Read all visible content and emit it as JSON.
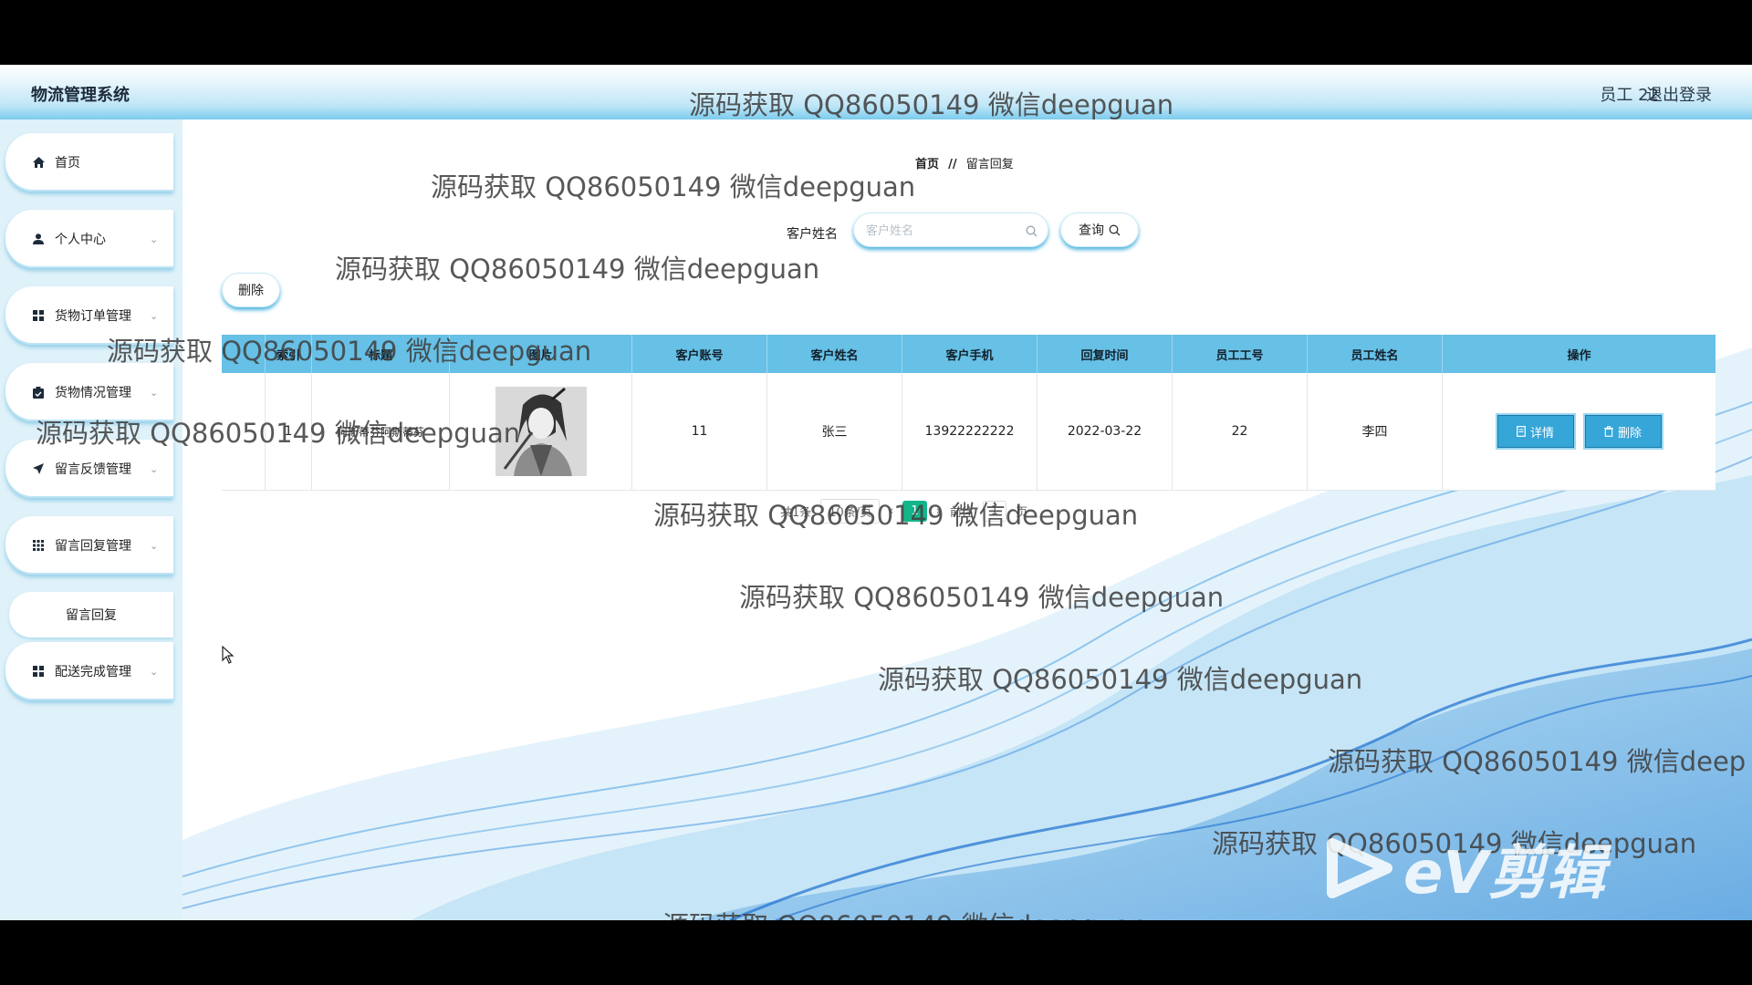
{
  "app": {
    "title": "物流管理系统"
  },
  "header": {
    "user": "员工 22",
    "logout": "退出登录"
  },
  "sidebar": {
    "items": [
      {
        "label": "首页",
        "icon": "home-icon"
      },
      {
        "label": "个人中心",
        "icon": "user-icon"
      },
      {
        "label": "货物订单管理",
        "icon": "grid-icon"
      },
      {
        "label": "货物情况管理",
        "icon": "clipboard-icon"
      },
      {
        "label": "留言反馈管理",
        "icon": "send-icon"
      },
      {
        "label": "留言回复管理",
        "icon": "grid-icon"
      },
      {
        "label": "配送完成管理",
        "icon": "grid-icon"
      }
    ],
    "sub_item": "留言回复"
  },
  "breadcrumb": {
    "home": "首页",
    "sep": "//",
    "current": "留言回复"
  },
  "search": {
    "label": "客户姓名",
    "placeholder": "客户姓名",
    "button": "查询"
  },
  "toolbar": {
    "delete": "删除"
  },
  "table": {
    "headers": [
      "",
      "索引",
      "标题",
      "图片",
      "客户账号",
      "客户姓名",
      "客户手机",
      "回复时间",
      "员工工号",
      "员工姓名",
      "操作"
    ],
    "rows": [
      {
        "index": "1",
        "title": "阿斯蒂芬阿斯蒂芬",
        "account": "11",
        "name": "张三",
        "phone": "13922222222",
        "time": "2022-03-22",
        "emp_no": "22",
        "emp_name": "李四",
        "detail": "详情",
        "delete": "删除"
      }
    ]
  },
  "pager": {
    "total": "共1条",
    "page_size": "10条/页",
    "current": "1",
    "goto": "前往",
    "page": "1",
    "page_suffix": "页"
  },
  "watermark": {
    "text": "源码获取 QQ86050149 微信deepguan",
    "text_cut": "源码获取 QQ86050149 微信deep"
  },
  "overlay_logo": {
    "text": "eV剪辑"
  },
  "colors": {
    "accent": "#36a6d8",
    "header_gradient_end": "#7ccbee",
    "sidebar_bg": "#dff1f9",
    "table_header": "#67c0e6"
  }
}
